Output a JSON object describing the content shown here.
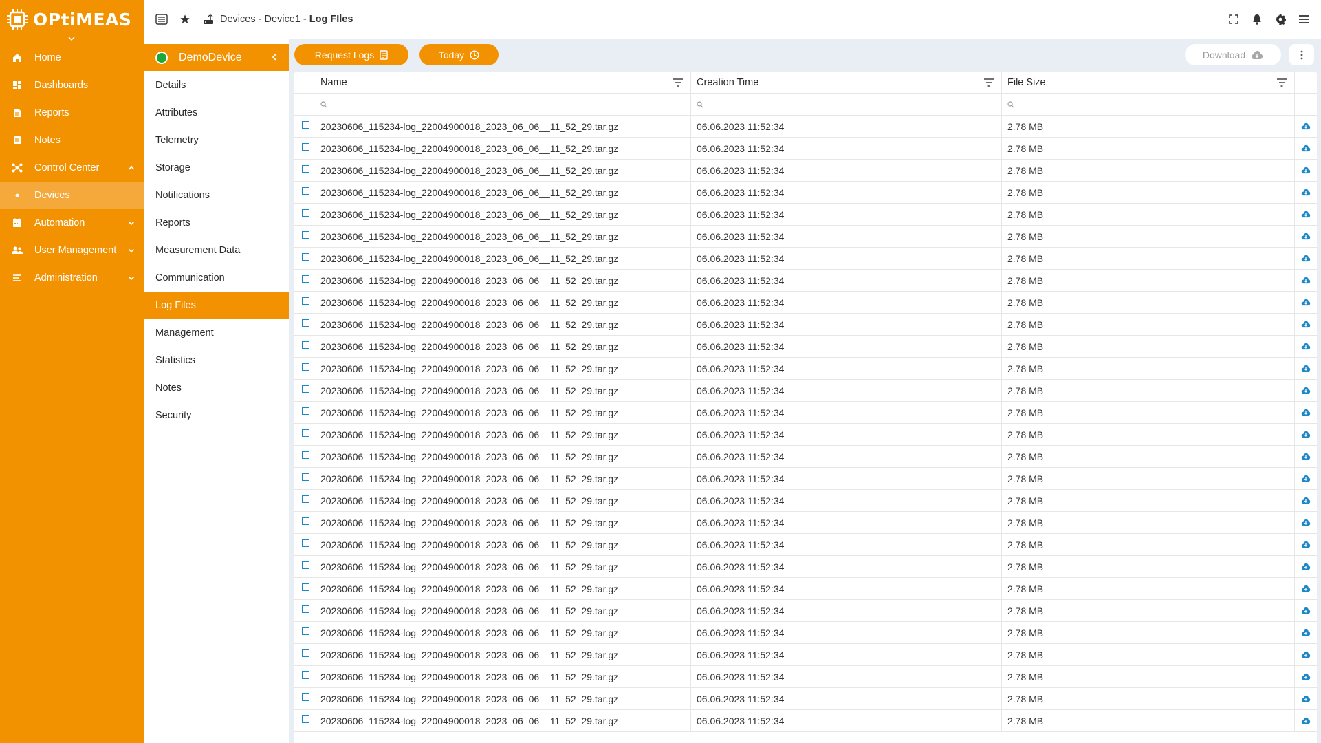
{
  "brand": {
    "name": "OPtiMEAS"
  },
  "nav": {
    "items": [
      {
        "label": "Home",
        "icon": "home-icon"
      },
      {
        "label": "Dashboards",
        "icon": "dashboard-icon"
      },
      {
        "label": "Reports",
        "icon": "report-icon"
      },
      {
        "label": "Notes",
        "icon": "notes-icon"
      },
      {
        "label": "Control Center",
        "icon": "control-center-icon",
        "caret": "up"
      },
      {
        "label": "Devices",
        "icon": "bullet-icon",
        "active": true
      },
      {
        "label": "Automation",
        "icon": "calendar-icon",
        "caret": "down"
      },
      {
        "label": "User Management",
        "icon": "users-icon",
        "caret": "down"
      },
      {
        "label": "Administration",
        "icon": "admin-icon",
        "caret": "down"
      }
    ]
  },
  "breadcrumb": {
    "part1": "Devices",
    "sep1": " - ",
    "part2": "Device1",
    "sep2": " - ",
    "current": "Log FIles"
  },
  "device": {
    "name": "DemoDevice",
    "status_color": "#1fa83a"
  },
  "sub_nav": [
    {
      "label": "Details"
    },
    {
      "label": "Attributes"
    },
    {
      "label": "Telemetry"
    },
    {
      "label": "Storage"
    },
    {
      "label": "Notifications"
    },
    {
      "label": "Reports"
    },
    {
      "label": "Measurement Data"
    },
    {
      "label": "Communication"
    },
    {
      "label": "Log Files",
      "active": true
    },
    {
      "label": "Management"
    },
    {
      "label": "Statistics"
    },
    {
      "label": "Notes"
    },
    {
      "label": "Security"
    }
  ],
  "toolbar": {
    "request_logs": "Request Logs",
    "today": "Today",
    "download": "Download"
  },
  "table": {
    "columns": [
      "Name",
      "Creation Time",
      "File Size"
    ],
    "rows": [
      [
        "20230606_115234-log_22004900018_2023_06_06__11_52_29.tar.gz",
        "06.06.2023 11:52:34",
        "2.78 MB"
      ],
      [
        "20230606_115234-log_22004900018_2023_06_06__11_52_29.tar.gz",
        "06.06.2023 11:52:34",
        "2.78 MB"
      ],
      [
        "20230606_115234-log_22004900018_2023_06_06__11_52_29.tar.gz",
        "06.06.2023 11:52:34",
        "2.78 MB"
      ],
      [
        "20230606_115234-log_22004900018_2023_06_06__11_52_29.tar.gz",
        "06.06.2023 11:52:34",
        "2.78 MB"
      ],
      [
        "20230606_115234-log_22004900018_2023_06_06__11_52_29.tar.gz",
        "06.06.2023 11:52:34",
        "2.78 MB"
      ],
      [
        "20230606_115234-log_22004900018_2023_06_06__11_52_29.tar.gz",
        "06.06.2023 11:52:34",
        "2.78 MB"
      ],
      [
        "20230606_115234-log_22004900018_2023_06_06__11_52_29.tar.gz",
        "06.06.2023 11:52:34",
        "2.78 MB"
      ],
      [
        "20230606_115234-log_22004900018_2023_06_06__11_52_29.tar.gz",
        "06.06.2023 11:52:34",
        "2.78 MB"
      ],
      [
        "20230606_115234-log_22004900018_2023_06_06__11_52_29.tar.gz",
        "06.06.2023 11:52:34",
        "2.78 MB"
      ],
      [
        "20230606_115234-log_22004900018_2023_06_06__11_52_29.tar.gz",
        "06.06.2023 11:52:34",
        "2.78 MB"
      ],
      [
        "20230606_115234-log_22004900018_2023_06_06__11_52_29.tar.gz",
        "06.06.2023 11:52:34",
        "2.78 MB"
      ],
      [
        "20230606_115234-log_22004900018_2023_06_06__11_52_29.tar.gz",
        "06.06.2023 11:52:34",
        "2.78 MB"
      ],
      [
        "20230606_115234-log_22004900018_2023_06_06__11_52_29.tar.gz",
        "06.06.2023 11:52:34",
        "2.78 MB"
      ],
      [
        "20230606_115234-log_22004900018_2023_06_06__11_52_29.tar.gz",
        "06.06.2023 11:52:34",
        "2.78 MB"
      ],
      [
        "20230606_115234-log_22004900018_2023_06_06__11_52_29.tar.gz",
        "06.06.2023 11:52:34",
        "2.78 MB"
      ],
      [
        "20230606_115234-log_22004900018_2023_06_06__11_52_29.tar.gz",
        "06.06.2023 11:52:34",
        "2.78 MB"
      ],
      [
        "20230606_115234-log_22004900018_2023_06_06__11_52_29.tar.gz",
        "06.06.2023 11:52:34",
        "2.78 MB"
      ],
      [
        "20230606_115234-log_22004900018_2023_06_06__11_52_29.tar.gz",
        "06.06.2023 11:52:34",
        "2.78 MB"
      ],
      [
        "20230606_115234-log_22004900018_2023_06_06__11_52_29.tar.gz",
        "06.06.2023 11:52:34",
        "2.78 MB"
      ],
      [
        "20230606_115234-log_22004900018_2023_06_06__11_52_29.tar.gz",
        "06.06.2023 11:52:34",
        "2.78 MB"
      ],
      [
        "20230606_115234-log_22004900018_2023_06_06__11_52_29.tar.gz",
        "06.06.2023 11:52:34",
        "2.78 MB"
      ],
      [
        "20230606_115234-log_22004900018_2023_06_06__11_52_29.tar.gz",
        "06.06.2023 11:52:34",
        "2.78 MB"
      ],
      [
        "20230606_115234-log_22004900018_2023_06_06__11_52_29.tar.gz",
        "06.06.2023 11:52:34",
        "2.78 MB"
      ],
      [
        "20230606_115234-log_22004900018_2023_06_06__11_52_29.tar.gz",
        "06.06.2023 11:52:34",
        "2.78 MB"
      ],
      [
        "20230606_115234-log_22004900018_2023_06_06__11_52_29.tar.gz",
        "06.06.2023 11:52:34",
        "2.78 MB"
      ],
      [
        "20230606_115234-log_22004900018_2023_06_06__11_52_29.tar.gz",
        "06.06.2023 11:52:34",
        "2.78 MB"
      ],
      [
        "20230606_115234-log_22004900018_2023_06_06__11_52_29.tar.gz",
        "06.06.2023 11:52:34",
        "2.78 MB"
      ],
      [
        "20230606_115234-log_22004900018_2023_06_06__11_52_29.tar.gz",
        "06.06.2023 11:52:34",
        "2.78 MB"
      ]
    ]
  },
  "colors": {
    "brand": "#f39200",
    "brand_light": "#f5a93a",
    "accent": "#1e88c7",
    "status_online": "#1fa83a"
  }
}
